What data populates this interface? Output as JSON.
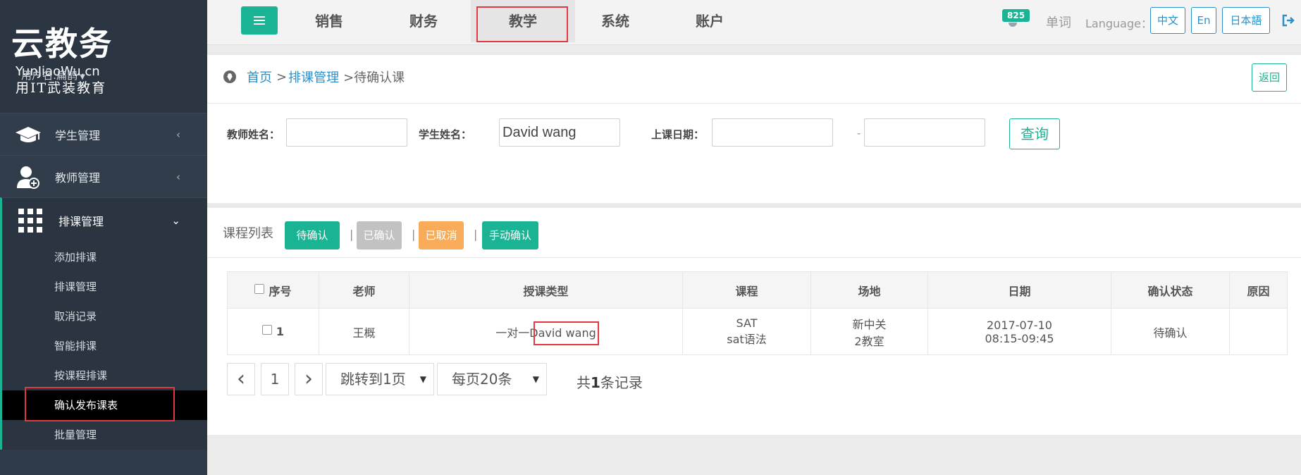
{
  "sidebar": {
    "logo_cn": "云教务",
    "logo_en": "YunJiaoWu.cn",
    "logo_slogan": "用IT武装教育",
    "user": "用户名:扁鹊",
    "nav": [
      {
        "label": "学生管理",
        "icon": "graduation-cap-icon"
      },
      {
        "label": "教师管理",
        "icon": "teacher-add-icon"
      },
      {
        "label": "排课管理",
        "icon": "grid-icon"
      }
    ],
    "sub_items": [
      "添加排课",
      "排课管理",
      "取消记录",
      "智能排课",
      "按课程排课",
      "确认发布课表",
      "批量管理"
    ]
  },
  "topbar": {
    "tabs": [
      "销售",
      "财务",
      "教学",
      "系统",
      "账户"
    ],
    "active_tab": "教学",
    "notification_count": "825",
    "word_link": "单词",
    "language_label": "Language：",
    "languages": [
      "中文",
      "En",
      "日本語"
    ]
  },
  "breadcrumb": {
    "home": "首页",
    "sep": ">",
    "parent": "排课管理",
    "current": ">待确认课"
  },
  "back_button": "返回",
  "search": {
    "teacher_label": "教师姓名：",
    "teacher_value": "",
    "student_label": "学生姓名：",
    "student_value": "David wang",
    "date_label": "上课日期：",
    "date_from": "",
    "date_sep": "-",
    "date_to": "",
    "query_button": "查询"
  },
  "list": {
    "title": "课程列表",
    "filters": [
      {
        "label": "待确认",
        "color": "#1ab394"
      },
      {
        "label": "已确认",
        "color": "#c2c2c2"
      },
      {
        "label": "已取消",
        "color": "#f8ac59"
      },
      {
        "label": "手动确认",
        "color": "#1ab394"
      }
    ],
    "separator": "|"
  },
  "table": {
    "headers": [
      "序号",
      "老师",
      "授课类型",
      "课程",
      "场地",
      "日期",
      "确认状态",
      "原因"
    ],
    "rows": [
      {
        "index": "1",
        "teacher": "王概",
        "type_prefix": "一对一",
        "type_student": "David wang",
        "course_line1": "SAT",
        "course_line2": "sat语法",
        "venue_line1": "新中关",
        "venue_line2": "2教室",
        "date_line1": "2017-07-10",
        "time_line2": "08:15-09:45",
        "status": "待确认",
        "reason": ""
      }
    ]
  },
  "pagination": {
    "prev": "‹",
    "current_page": "1",
    "next": "›",
    "jump": "跳转到1页",
    "per_page": "每页20条",
    "total_prefix": "共",
    "total_count": "1",
    "total_suffix": "条记录"
  }
}
